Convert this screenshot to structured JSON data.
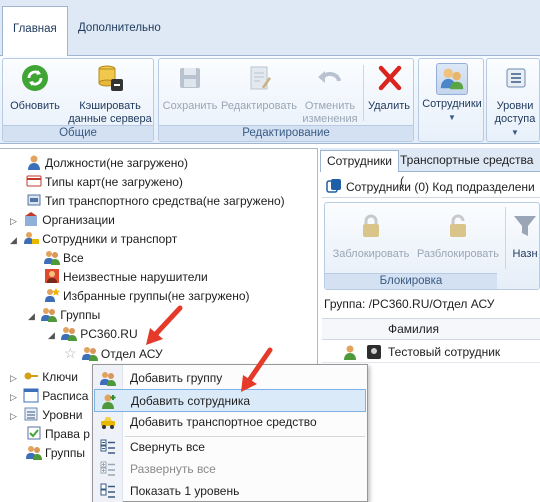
{
  "tabs": [
    "Главная",
    "Дополнительно"
  ],
  "ribbon": {
    "groups": {
      "general": "Общие",
      "editing": "Редактирование"
    },
    "buttons": {
      "refresh": "Обновить",
      "cache_line1": "Кэшировать",
      "cache_line2": "данные сервера",
      "save": "Сохранить",
      "edit": "Редактировать",
      "undo_line1": "Отменить",
      "undo_line2": "изменения",
      "delete": "Удалить",
      "employees": "Сотрудники",
      "levels_line1": "Уровни",
      "levels_line2": "доступа"
    }
  },
  "tree": {
    "items": [
      "Должности(не загружено)",
      "Типы карт(не загружено)",
      "Тип транспортного средства(не загружено)",
      "Организации",
      "Сотрудники и транспорт",
      "Все",
      "Неизвестные нарушители",
      "Избранные группы(не загружено)",
      "Группы",
      "PC360.RU",
      "Отдел АСУ",
      "Ключи",
      "Расписа",
      "Уровни",
      "Права р",
      "Группы"
    ]
  },
  "right": {
    "tabs": [
      "Сотрудники",
      "Транспортные средства ("
    ],
    "subtitle": "Сотрудники (0) Код подразделени",
    "block": "Заблокировать",
    "unblock": "Разблокировать",
    "assign": "Назн",
    "block_group": "Блокировка",
    "group_path": "Группа: /PC360.RU/Отдел АСУ",
    "col_surname": "Фамилия",
    "row_name": "Тестовый сотрудник"
  },
  "context_menu": {
    "items": [
      "Добавить группу",
      "Добавить сотрудника",
      "Добавить транспортное средство",
      "Свернуть все",
      "Развернуть все",
      "Показать 1 уровень"
    ]
  },
  "colors": {
    "highlight": "#dbeaf9",
    "arrow": "#e53a2a",
    "ribbon_bg": "#e4edf8"
  }
}
